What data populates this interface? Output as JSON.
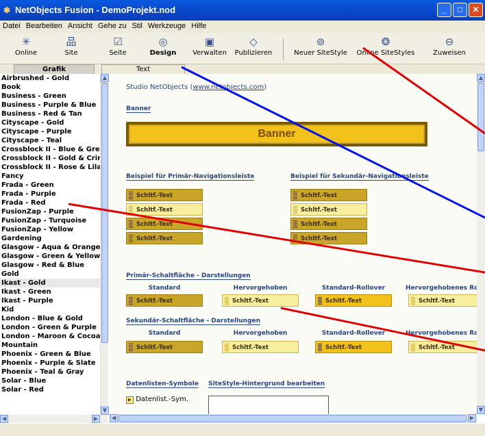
{
  "window": {
    "title": "NetObjects Fusion - DemoProjekt.nod"
  },
  "menu": [
    "Datei",
    "Bearbeiten",
    "Ansicht",
    "Gehe zu",
    "Stil",
    "Werkzeuge",
    "Hilfe"
  ],
  "toolbar": {
    "online": "Online",
    "site": "Site",
    "seite": "Seite",
    "design": "Design",
    "verwalten": "Verwalten",
    "publizieren": "Publizieren",
    "neuer_sitestyle": "Neuer SiteStyle",
    "online_sitestyles": "Online SiteStyles",
    "zuweisen": "Zuweisen"
  },
  "tabs": {
    "grafik": "Grafik",
    "text": "Text"
  },
  "styles": [
    "Airbrushed - Gold",
    "Book",
    "Business - Green",
    "Business - Purple & Blue",
    "Business - Red & Tan",
    "Cityscape - Gold",
    "Cityscape - Purple",
    "Cityscape - Teal",
    "Crossblock II - Blue & Green",
    "Crossblock II - Gold & Crimson",
    "Crossblock II - Rose & Lilac",
    "Fancy",
    "Frada - Green",
    "Frada - Purple",
    "Frada - Red",
    "FusionZap - Purple",
    "FusionZap - Turquoise",
    "FusionZap - Yellow",
    "Gardening",
    "Glasgow - Aqua & Orange",
    "Glasgow - Green & Yellow",
    "Glasgow - Red & Blue",
    "Gold",
    "Ikast - Gold",
    "Ikast - Green",
    "Ikast - Purple",
    "Kid",
    "London - Blue & Gold",
    "London - Green & Purple",
    "London - Maroon & Cocoa",
    "Mountain",
    "Phoenix - Green & Blue",
    "Phoenix - Purple & Slate",
    "Phoenix - Teal & Gray",
    "Solar - Blue",
    "Solar - Red"
  ],
  "selected_style": "Ikast - Gold",
  "preview": {
    "studio": "Studio NetObjects (",
    "studio_link": "www.netobjects.com",
    "studio_end": ")",
    "banner_heading": "Banner",
    "banner_text": "Banner",
    "primary_nav_heading": "Beispiel für Primär-Navigationsleiste",
    "secondary_nav_heading": "Beispiel für Sekundär-Navigationsleiste",
    "button_text": "Schltf.-Text",
    "primary_states_heading": "Primär-Schaltfläche - Darstellungen",
    "secondary_states_heading": "Sekundär-Schaltfläche - Darstellungen",
    "state_standard": "Standard",
    "state_highlighted": "Hervorgehoben",
    "state_rollover": "Standard-Rollover",
    "state_highlighted_rollover": "Hervorgehobenes Rollover",
    "datalist_heading": "Datenlisten-Symbole",
    "background_heading": "SiteStyle-Hintergrund bearbeiten",
    "datalist_symbol": "Datenlist.-Sym."
  },
  "colors": {
    "titlebar": "#0a5ae0",
    "gold_dark": "#c9a52a",
    "gold_yellow": "#f2c21a",
    "gold_pale": "#f7eea0",
    "heading_blue": "#2a4580",
    "annotation_red": "#e00000",
    "annotation_blue": "#0010ee"
  }
}
